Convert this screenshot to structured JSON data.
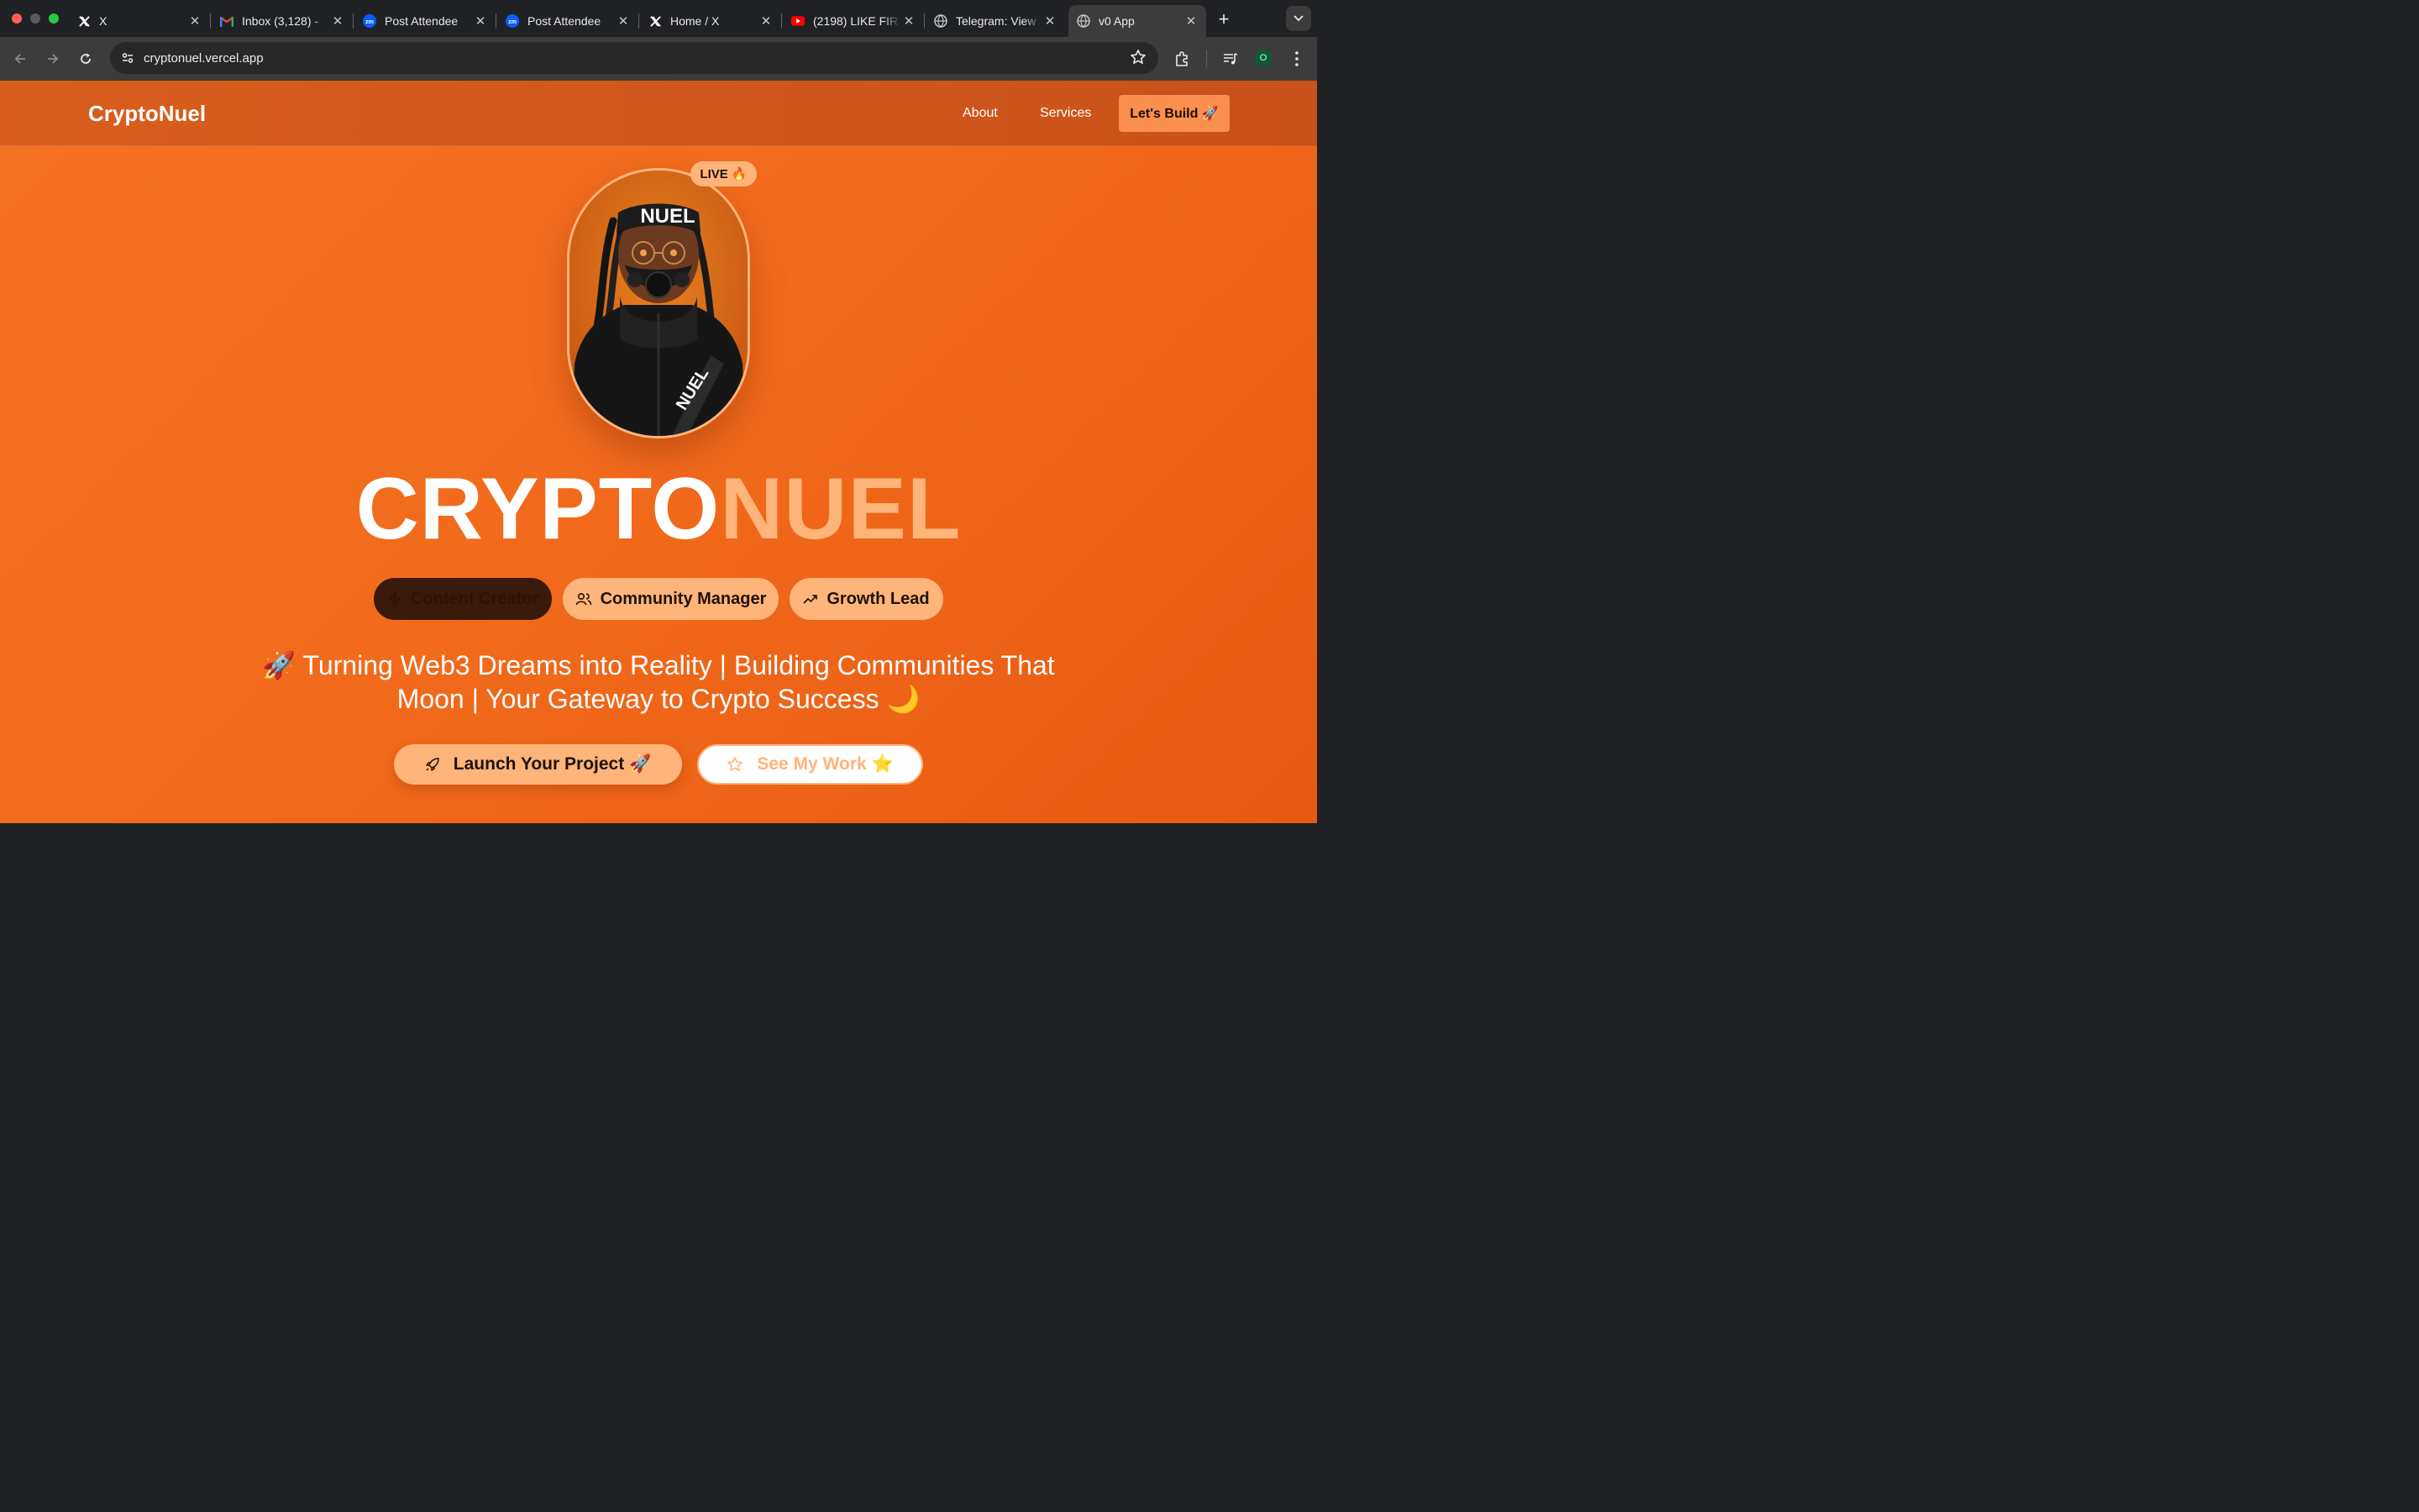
{
  "browser": {
    "tabs": [
      {
        "title": "X",
        "icon": "x-logo-icon"
      },
      {
        "title": "Inbox (3,128) - ",
        "icon": "gmail-icon"
      },
      {
        "title": "Post Attendee",
        "icon": "zoom-icon"
      },
      {
        "title": "Post Attendee",
        "icon": "zoom-icon"
      },
      {
        "title": "Home / X",
        "icon": "x-logo-icon"
      },
      {
        "title": "(2198) LIKE FIR",
        "icon": "youtube-icon"
      },
      {
        "title": "Telegram: View",
        "icon": "globe-icon"
      },
      {
        "title": "v0 App",
        "icon": "globe-icon",
        "active": true
      }
    ],
    "url": "cryptonuel.vercel.app",
    "profile_initial": "O"
  },
  "site": {
    "brand": "CryptoNuel",
    "nav": {
      "about": "About",
      "services": "Services",
      "cta": "Let's Build 🚀"
    },
    "live_badge": "LIVE 🔥",
    "avatar_text": {
      "headband": "NUEL",
      "strap": "NUEL"
    },
    "hero_title_part1": "CRYPTO",
    "hero_title_part2": "NUEL",
    "roles": [
      "Content Creator",
      "Community Manager",
      "Growth Lead"
    ],
    "tagline": "🚀 Turning Web3 Dreams into Reality | Building Communities That Moon | Your Gateway to Crypto Success 🌙",
    "buttons": {
      "primary": "Launch Your Project 🚀",
      "secondary": "See My Work ⭐"
    }
  },
  "colors": {
    "page_orange": "#f26b1c",
    "nav_orange": "#d95e1d",
    "accent_peach": "#ffb47a",
    "dark_pill": "#3a1a0a"
  }
}
